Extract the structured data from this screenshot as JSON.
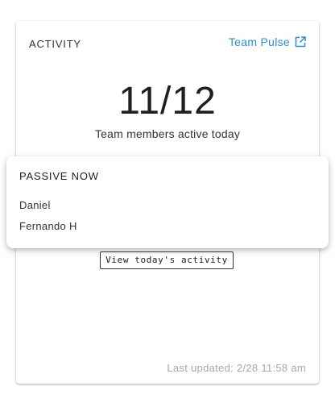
{
  "card": {
    "title": "ACTIVITY",
    "link_label": "Team Pulse",
    "link_icon": "external-link-icon",
    "count": "11/12",
    "caption": "Team members active today",
    "button_label": "View today's activity",
    "last_updated": "Last updated: 2/28 11:58 am"
  },
  "popover": {
    "title": "PASSIVE NOW",
    "members": [
      "Daniel",
      "Fernando H"
    ]
  },
  "colors": {
    "link": "#2b8fd0",
    "muted_text": "#a8a8a8",
    "primary_text": "#1f1f1f"
  }
}
